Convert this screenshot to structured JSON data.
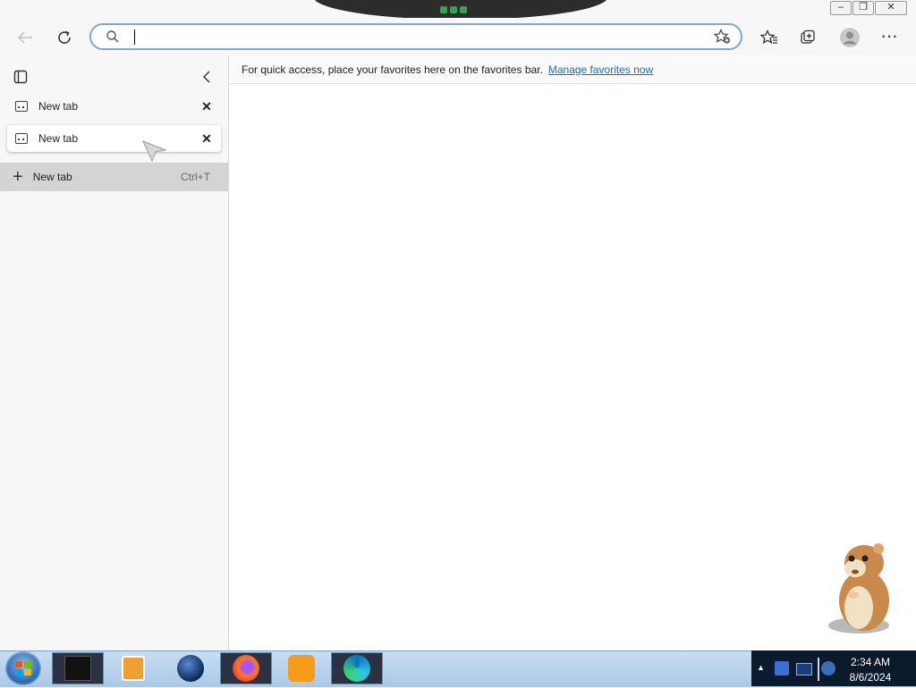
{
  "toolbar": {
    "back_icon": "back-arrow-icon",
    "refresh_icon": "refresh-icon",
    "address_value": "",
    "address_placeholder": "",
    "favorite_star_icon": "add-favorite-icon",
    "favorites_icon": "favorites-icon",
    "collections_icon": "collections-icon",
    "profile_icon": "profile-icon",
    "more_icon": "more-icon"
  },
  "window_controls": {
    "minimize": "–",
    "restore": "❐",
    "close": "✕"
  },
  "sidebar": {
    "tabs": [
      {
        "label": "New tab"
      },
      {
        "label": "New tab"
      }
    ],
    "new_tab": {
      "label": "New tab",
      "shortcut": "Ctrl+T"
    }
  },
  "favorites_bar": {
    "text": "For quick access, place your favorites here on the favorites bar.",
    "link": "Manage favorites now"
  },
  "taskbar": {
    "items": [
      "terminal",
      "media-player",
      "browser-globe",
      "firefox",
      "uc-browser",
      "edge"
    ],
    "time": "2:34 AM",
    "date": "8/6/2024"
  },
  "colors": {
    "accent": "#1a6eb5",
    "taskbar": "#b7d2ec",
    "tray": "#0c1a2e"
  }
}
